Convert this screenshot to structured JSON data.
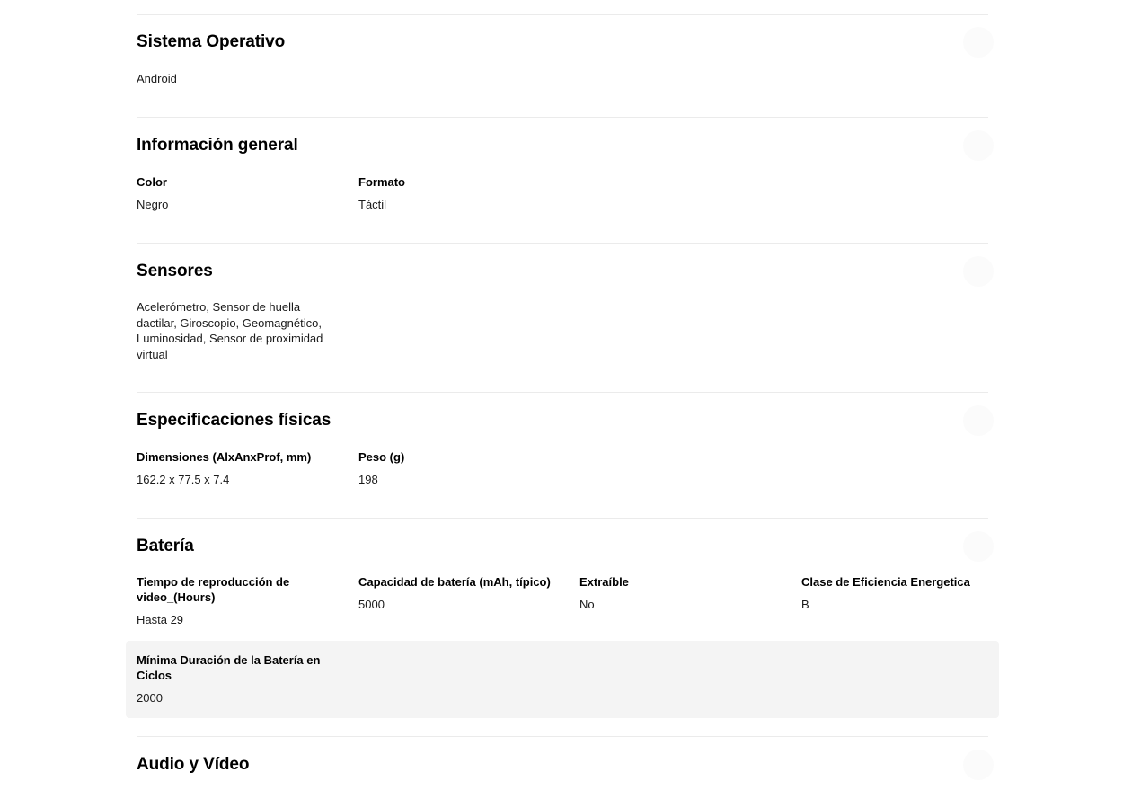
{
  "sections": {
    "os": {
      "title": "Sistema Operativo",
      "value": "Android"
    },
    "general": {
      "title": "Información general",
      "specs": [
        {
          "label": "Color",
          "value": "Negro"
        },
        {
          "label": "Formato",
          "value": "Táctil"
        }
      ]
    },
    "sensors": {
      "title": "Sensores",
      "value": "Acelerómetro, Sensor de huella dactilar, Giroscopio, Geomagnético, Luminosidad, Sensor de proximidad virtual"
    },
    "physical": {
      "title": "Especificaciones físicas",
      "specs": [
        {
          "label": "Dimensiones (AlxAnxProf, mm)",
          "value": "162.2 x 77.5 x 7.4"
        },
        {
          "label": "Peso (g)",
          "value": "198"
        }
      ]
    },
    "battery": {
      "title": "Batería",
      "specs": [
        {
          "label": "Tiempo de reproducción de video_(Hours)",
          "value": "Hasta 29"
        },
        {
          "label": "Capacidad de batería (mAh, típico)",
          "value": "5000"
        },
        {
          "label": "Extraíble",
          "value": "No"
        },
        {
          "label": "Clase de Eficiencia Energetica",
          "value": "B"
        },
        {
          "label": "Mínima Duración de la Batería en Ciclos",
          "value": "2000"
        }
      ]
    },
    "audio_video": {
      "title": "Audio y Vídeo"
    }
  },
  "colors": {
    "divider": "#ebebeb",
    "highlight_row": "#f4f4f4",
    "text": "#000000"
  }
}
